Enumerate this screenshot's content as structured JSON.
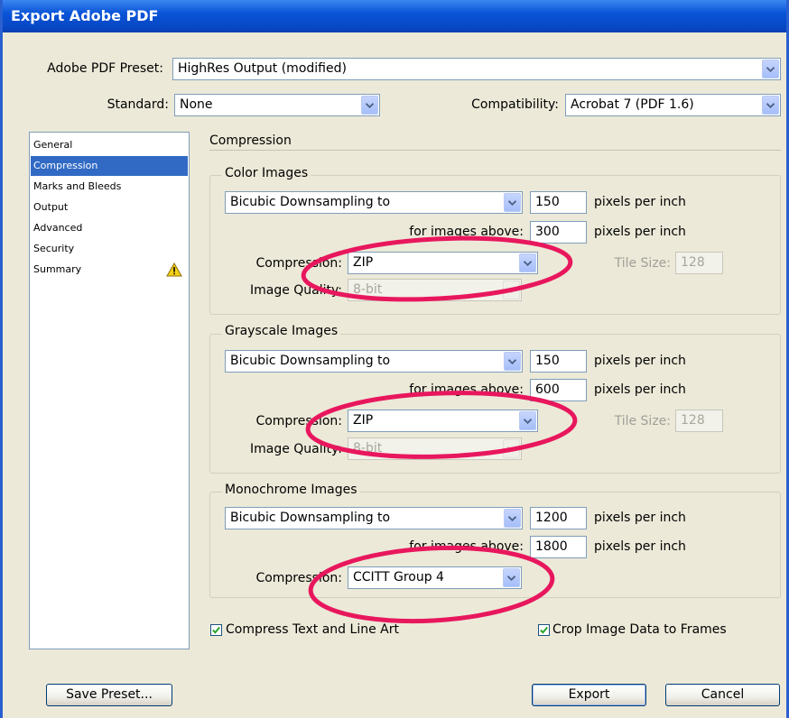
{
  "window": {
    "title": "Export Adobe PDF"
  },
  "preset": {
    "label": "Adobe PDF Preset:",
    "value": "HighRes Output (modified)"
  },
  "standard": {
    "label": "Standard:",
    "value": "None"
  },
  "compatibility": {
    "label": "Compatibility:",
    "value": "Acrobat 7 (PDF 1.6)"
  },
  "sidebar": {
    "items": [
      {
        "label": "General"
      },
      {
        "label": "Compression"
      },
      {
        "label": "Marks and Bleeds"
      },
      {
        "label": "Output"
      },
      {
        "label": "Advanced"
      },
      {
        "label": "Security"
      },
      {
        "label": "Summary"
      }
    ],
    "selected_index": 1
  },
  "section": {
    "title": "Compression"
  },
  "color_images": {
    "title": "Color Images",
    "sampling": "Bicubic Downsampling to",
    "resolution": "150",
    "resolution_unit": "pixels per inch",
    "above_label": "for images above:",
    "above_value": "300",
    "above_unit": "pixels per inch",
    "compression_label": "Compression:",
    "compression": "ZIP",
    "tile_label": "Tile Size:",
    "tile_value": "128",
    "quality_label": "Image Quality:",
    "quality": "8-bit"
  },
  "grayscale_images": {
    "title": "Grayscale Images",
    "sampling": "Bicubic Downsampling to",
    "resolution": "150",
    "resolution_unit": "pixels per inch",
    "above_label": "for images above:",
    "above_value": "600",
    "above_unit": "pixels per inch",
    "compression_label": "Compression:",
    "compression": "ZIP",
    "tile_label": "Tile Size:",
    "tile_value": "128",
    "quality_label": "Image Quality:",
    "quality": "8-bit"
  },
  "monochrome_images": {
    "title": "Monochrome Images",
    "sampling": "Bicubic Downsampling to",
    "resolution": "1200",
    "resolution_unit": "pixels per inch",
    "above_label": "for images above:",
    "above_value": "1800",
    "above_unit": "pixels per inch",
    "compression_label": "Compression:",
    "compression": "CCITT Group 4"
  },
  "options": {
    "compress_text": {
      "label": "Compress Text and Line Art",
      "checked": true
    },
    "crop_image": {
      "label": "Crop Image Data to Frames",
      "checked": true
    }
  },
  "buttons": {
    "save_preset": "Save Preset...",
    "export": "Export",
    "cancel": "Cancel"
  },
  "colors": {
    "titlebar": "#0a55d8",
    "selection": "#316ac5",
    "annotation_ring": "#e8175d",
    "dialog_bg": "#ece9d8"
  }
}
